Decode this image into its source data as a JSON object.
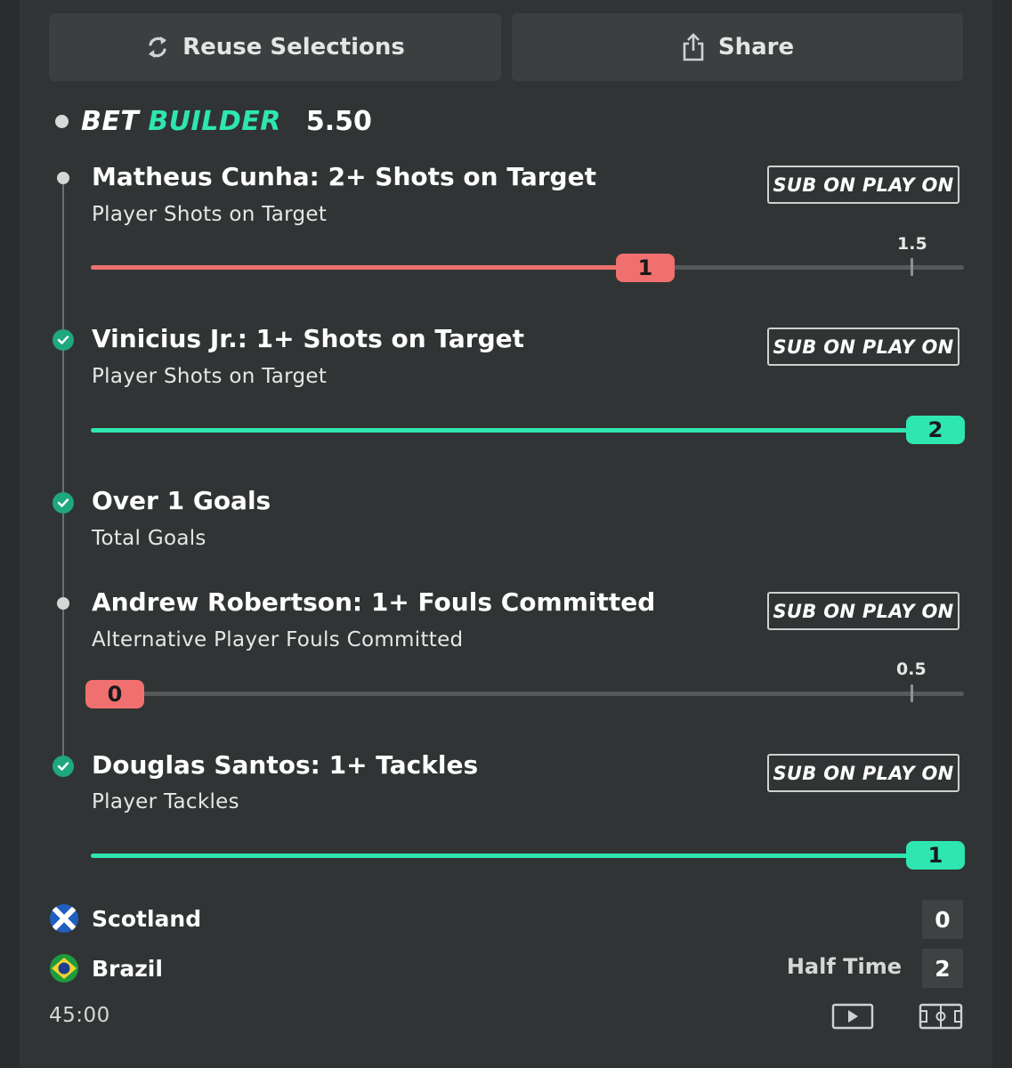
{
  "actions": {
    "reuse_label": "Reuse Selections",
    "share_label": "Share"
  },
  "bet": {
    "type_word1": "BET",
    "type_word2": "BUILDER",
    "odds": "5.50",
    "accent_color": "#2ee6b0",
    "lose_color": "#f0706f"
  },
  "selections": [
    {
      "title": "Matheus Cunha: 2+ Shots on Target",
      "market": "Player Shots on Target",
      "status": "pending",
      "badge": "SUB ON PLAY ON",
      "progress": {
        "current": "1",
        "target": "1.5",
        "fraction": 0.63
      }
    },
    {
      "title": "Vinicius Jr.: 1+ Shots on Target",
      "market": "Player Shots on Target",
      "status": "won",
      "badge": "SUB ON PLAY ON",
      "progress": {
        "current": "2",
        "fraction": 1.0
      }
    },
    {
      "title": "Over 1 Goals",
      "market": "Total Goals",
      "status": "won"
    },
    {
      "title": "Andrew Robertson: 1+ Fouls Committed",
      "market": "Alternative Player Fouls Committed",
      "status": "pending",
      "badge": "SUB ON PLAY ON",
      "progress": {
        "current": "0",
        "target": "0.5",
        "fraction": 0.0
      }
    },
    {
      "title": "Douglas Santos: 1+ Tackles",
      "market": "Player Tackles",
      "status": "won",
      "badge": "SUB ON PLAY ON",
      "progress": {
        "current": "1",
        "fraction": 1.0
      }
    }
  ],
  "match": {
    "home": {
      "name": "Scotland",
      "score": "0",
      "flag_icon": "scotland-flag-icon"
    },
    "away": {
      "name": "Brazil",
      "score": "2",
      "flag_icon": "brazil-flag-icon"
    },
    "period": "Half Time",
    "clock": "45:00"
  }
}
